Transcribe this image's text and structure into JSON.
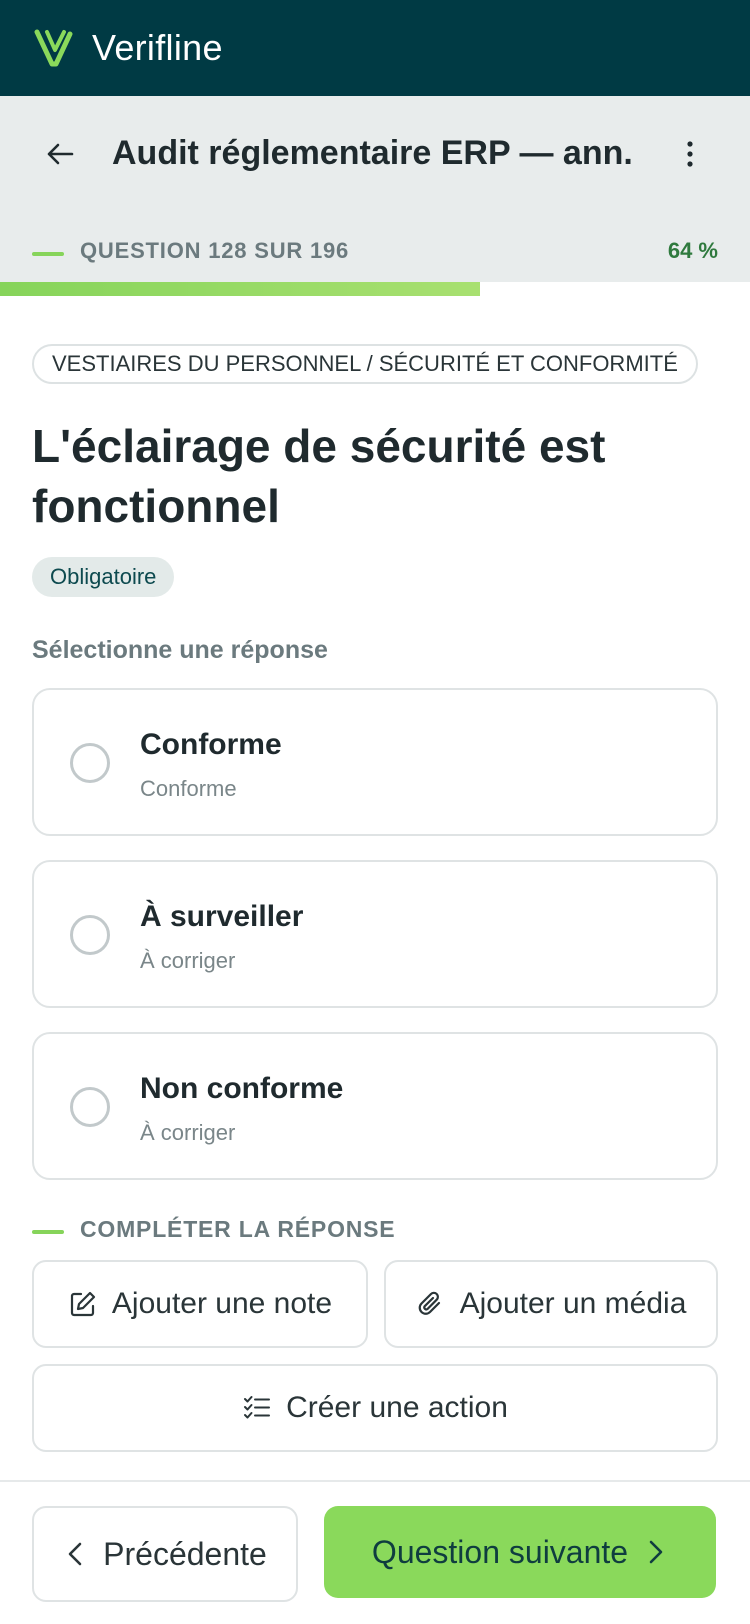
{
  "app": {
    "name": "Verifline",
    "brand_color": "#003a44",
    "accent_color": "#8ad95b"
  },
  "header": {
    "back_icon": "arrow-left-icon",
    "audit_title": "Audit réglementaire ERP — ann...",
    "more_icon": "more-vertical-icon",
    "question_counter": "QUESTION 128 SUR 196",
    "progress_label": "64 %",
    "progress_fraction": 0.64
  },
  "question": {
    "breadcrumb": "VESTIAIRES DU PERSONNEL / SÉCURITÉ ET CONFORMITÉ",
    "title": "L'éclairage de sécurité est fonctionnel",
    "required_badge": "Obligatoire",
    "select_prompt": "Sélectionne une réponse",
    "options": [
      {
        "label": "Conforme",
        "sublabel": "Conforme",
        "selected": false
      },
      {
        "label": "À surveiller",
        "sublabel": "À corriger",
        "selected": false
      },
      {
        "label": "Non conforme",
        "sublabel": "À corriger",
        "selected": false
      }
    ]
  },
  "complete": {
    "section_label": "COMPLÉTER LA RÉPONSE",
    "add_note": "Ajouter une note",
    "add_note_icon": "edit-note-icon",
    "add_media": "Ajouter un média",
    "add_media_icon": "paperclip-icon",
    "create_action": "Créer une action",
    "create_action_icon": "checklist-icon"
  },
  "footer": {
    "previous": "Précédente",
    "next": "Question suivante"
  }
}
